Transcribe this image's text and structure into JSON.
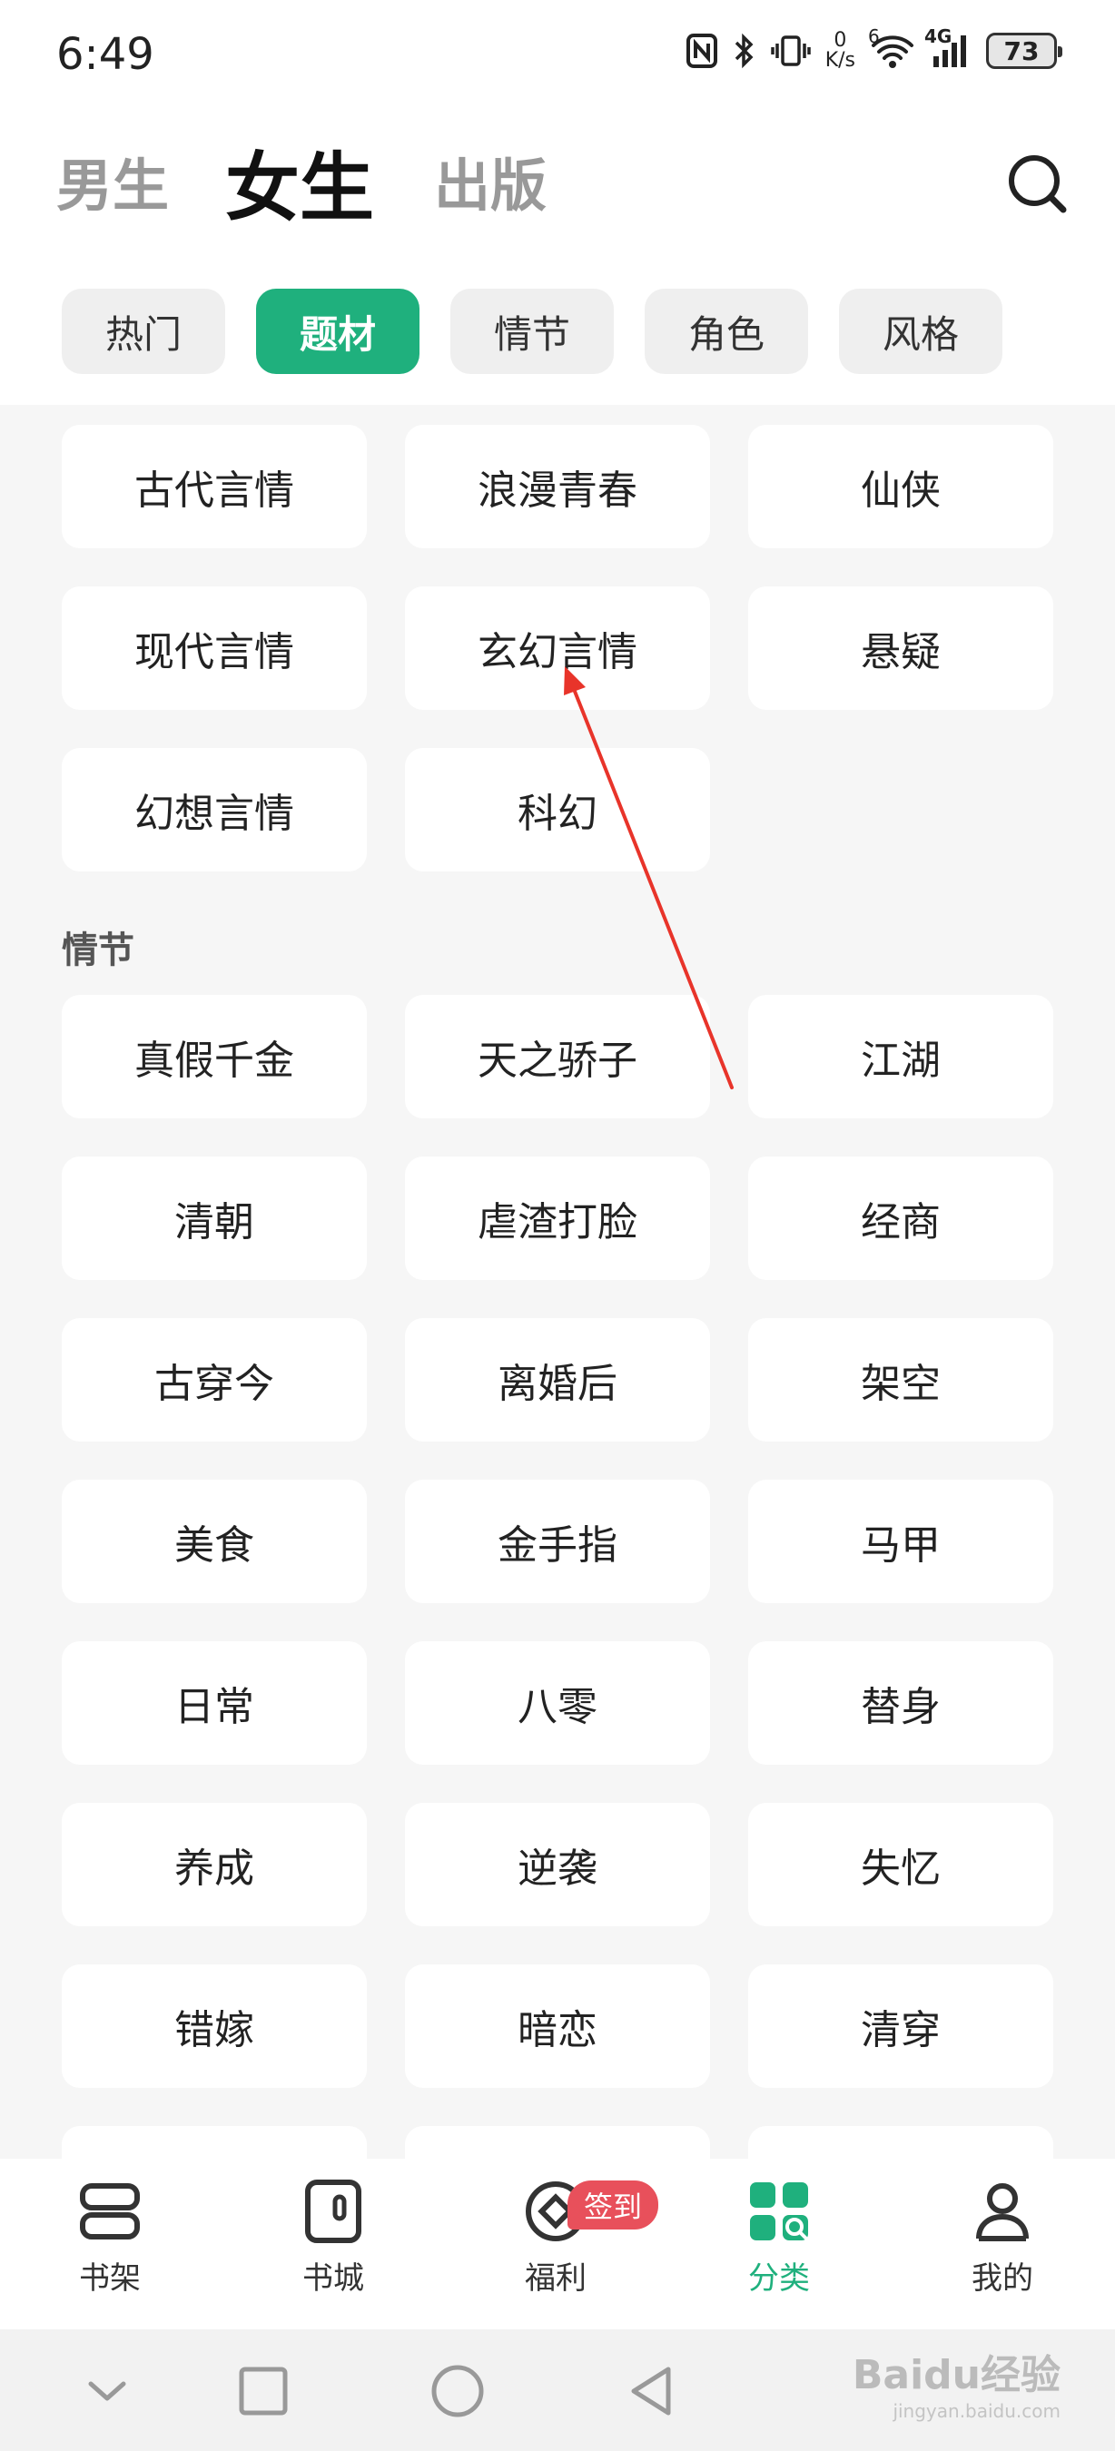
{
  "status_bar": {
    "time": "6:49",
    "net_speed_value": "0",
    "net_speed_unit": "K/s",
    "signal_label": "4G",
    "wifi_label": "6",
    "battery": "73"
  },
  "top_tabs": [
    {
      "label": "男生",
      "active": false
    },
    {
      "label": "女生",
      "active": true
    },
    {
      "label": "出版",
      "active": false
    }
  ],
  "filter_chips": [
    {
      "label": "热门",
      "active": false
    },
    {
      "label": "题材",
      "active": true
    },
    {
      "label": "情节",
      "active": false
    },
    {
      "label": "角色",
      "active": false
    },
    {
      "label": "风格",
      "active": false
    }
  ],
  "topic_section": {
    "items": [
      "古代言情",
      "浪漫青春",
      "仙侠",
      "现代言情",
      "玄幻言情",
      "悬疑",
      "幻想言情",
      "科幻"
    ]
  },
  "plot_section": {
    "title": "情节",
    "items": [
      "真假千金",
      "天之骄子",
      "江湖",
      "清朝",
      "虐渣打脸",
      "经商",
      "古穿今",
      "离婚后",
      "架空",
      "美食",
      "金手指",
      "马甲",
      "日常",
      "八零",
      "替身",
      "养成",
      "逆袭",
      "失忆",
      "错嫁",
      "暗恋",
      "清穿"
    ]
  },
  "bottom_nav": [
    {
      "label": "书架",
      "icon": "bookshelf-icon",
      "active": false
    },
    {
      "label": "书城",
      "icon": "bookstore-icon",
      "active": false
    },
    {
      "label": "福利",
      "icon": "welfare-icon",
      "active": false,
      "badge": "签到"
    },
    {
      "label": "分类",
      "icon": "category-icon",
      "active": true
    },
    {
      "label": "我的",
      "icon": "profile-icon",
      "active": false
    }
  ],
  "watermark": {
    "text": "Baidu经验",
    "sub": "jingyan.baidu.com"
  },
  "colors": {
    "accent": "#1fb07d",
    "badge": "#e8505b",
    "arrow": "#e8342a"
  }
}
